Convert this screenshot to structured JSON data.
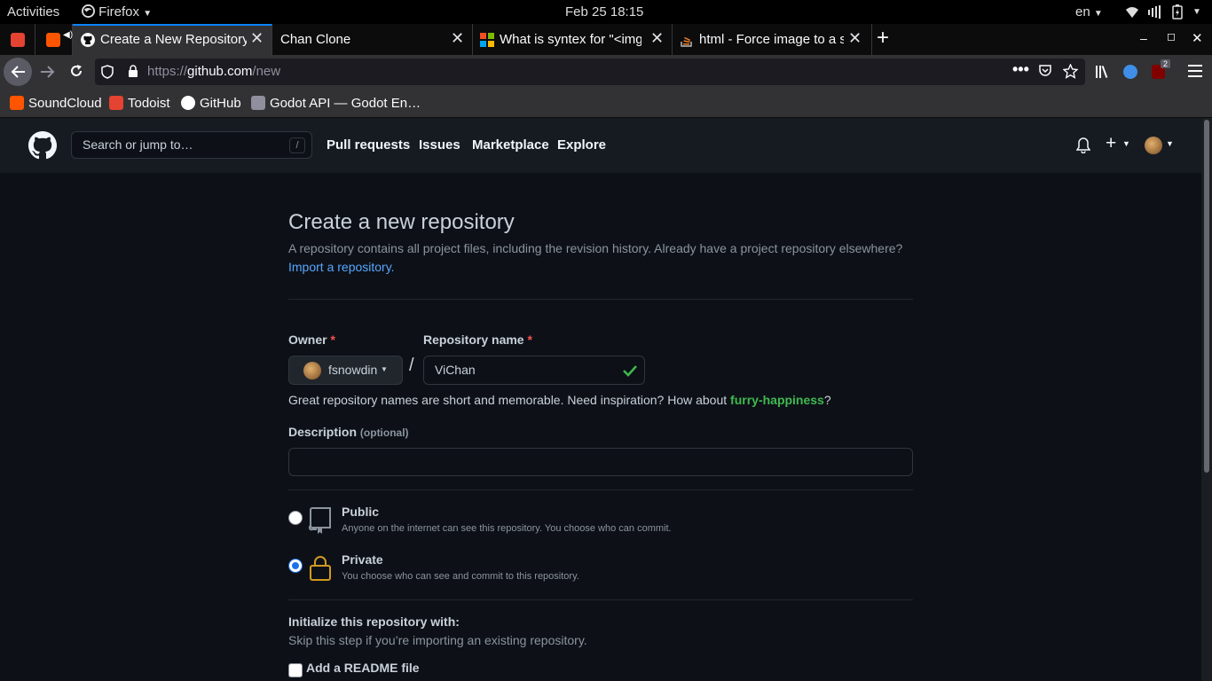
{
  "system": {
    "activities": "Activities",
    "app_name": "Firefox",
    "datetime": "Feb 25  18:15",
    "language": "en"
  },
  "tabs": [
    {
      "label": "",
      "favicon": "todoist-icon"
    },
    {
      "label": "",
      "favicon": "soundcloud-icon"
    },
    {
      "label": "Create a New Repository",
      "favicon": "github-icon",
      "active": true
    },
    {
      "label": "Chan Clone",
      "favicon": ""
    },
    {
      "label": "What is syntex for \"<img",
      "favicon": "microsoft-icon"
    },
    {
      "label": "html - Force image to a sp",
      "favicon": "stackoverflow-icon"
    }
  ],
  "url": {
    "prefix": "https://",
    "host": "github.com",
    "path": "/new"
  },
  "extension_badge": "2",
  "bookmarks": [
    "SoundCloud",
    "Todoist",
    "GitHub",
    "Godot API — Godot En…"
  ],
  "github": {
    "search_placeholder": "Search or jump to…",
    "search_key": "/",
    "nav": [
      "Pull requests",
      "Issues",
      "Marketplace",
      "Explore"
    ]
  },
  "page": {
    "title": "Create a new repository",
    "subtitle": "A repository contains all project files, including the revision history. Already have a project repository elsewhere?",
    "import_link": "Import a repository.",
    "owner_label": "Owner",
    "owner_value": "fsnowdin",
    "repo_label": "Repository name",
    "repo_value": "ViChan",
    "required_mark": "*",
    "separator": "/",
    "hint_prefix": "Great repository names are short and memorable. Need inspiration? How about ",
    "hint_suggestion": "furry-happiness",
    "hint_suffix": "?",
    "description_label": "Description",
    "description_optional": "(optional)",
    "description_value": "",
    "visibility": [
      {
        "title": "Public",
        "desc": "Anyone on the internet can see this repository. You choose who can commit.",
        "checked": false
      },
      {
        "title": "Private",
        "desc": "You choose who can see and commit to this repository.",
        "checked": true
      }
    ],
    "init_title": "Initialize this repository with:",
    "init_subtitle": "Skip this step if you’re importing an existing repository.",
    "readme_label": "Add a README file",
    "readme_checked": false
  },
  "colors": {
    "accent_link": "#58a6ff",
    "success": "#3fb950",
    "private_lock": "#d29922",
    "required": "#f85149",
    "firefox_tab_line": "#0a84ff"
  }
}
